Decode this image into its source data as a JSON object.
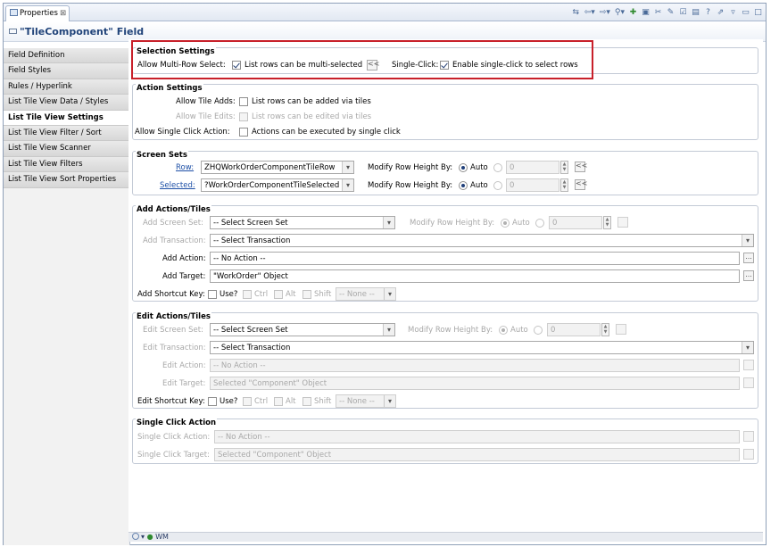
{
  "tab": {
    "title": "Properties",
    "close": "⊠"
  },
  "toolbar": {
    "icons": [
      "link-icon",
      "back-icon",
      "dropdown-icon",
      "forward-icon",
      "dropdown-icon",
      "history-icon",
      "dropdown-icon",
      "add-icon",
      "new-icon",
      "cut-icon",
      "edit-icon",
      "check-icon",
      "save-icon",
      "help-icon",
      "export-icon",
      "view-menu-icon",
      "minimize-icon",
      "maximize-icon"
    ]
  },
  "header": {
    "title": "\"TileComponent\" Field"
  },
  "nav": {
    "items": [
      "Field Definition",
      "Field Styles",
      "Rules / Hyperlink",
      "List Tile View Data / Styles",
      "List Tile View Settings",
      "List Tile View Filter / Sort",
      "List Tile View Scanner",
      "List Tile View Filters",
      "List Tile View Sort Properties"
    ],
    "selected": 4
  },
  "selection": {
    "title": "Selection Settings",
    "multi_label": "Allow Multi-Row Select:",
    "multi_cb": "List rows can be multi-selected",
    "multi_btn": "<<",
    "single_label": "Single-Click:",
    "single_cb": "Enable single-click to select rows"
  },
  "action": {
    "title": "Action Settings",
    "adds_label": "Allow Tile Adds:",
    "adds_cb": "List rows can be added via tiles",
    "edits_label": "Allow Tile Edits:",
    "edits_cb": "List rows can be edited via tiles",
    "click_label": "Allow Single Click Action:",
    "click_cb": "Actions can be executed by single click"
  },
  "screen": {
    "title": "Screen Sets",
    "row_label": "Row:",
    "row_value": "ZHQWorkOrderComponentTileRow",
    "sel_label": "Selected:",
    "sel_value": "?WorkOrderComponentTileSelected",
    "modify_label": "Modify Row Height By:",
    "auto": "Auto",
    "height": "0",
    "btn": "<<"
  },
  "add": {
    "title": "Add Actions/Tiles",
    "screen_label": "Add Screen Set:",
    "screen_value": "-- Select Screen Set",
    "modify_label": "Modify Row Height By:",
    "auto": "Auto",
    "height": "0",
    "trans_label": "Add Transaction:",
    "trans_value": "-- Select Transaction",
    "action_label": "Add Action:",
    "action_value": "-- No Action --",
    "target_label": "Add Target:",
    "target_value": "\"WorkOrder\" Object",
    "browse": "...",
    "key_label": "Add Shortcut Key:",
    "use": "Use?",
    "ctrl": "Ctrl",
    "alt": "Alt",
    "shift": "Shift",
    "none": "-- None --"
  },
  "edit": {
    "title": "Edit Actions/Tiles",
    "screen_label": "Edit Screen Set:",
    "screen_value": "-- Select Screen Set",
    "modify_label": "Modify Row Height By:",
    "auto": "Auto",
    "height": "0",
    "trans_label": "Edit Transaction:",
    "trans_value": "-- Select Transaction",
    "action_label": "Edit Action:",
    "action_value": "-- No Action --",
    "target_label": "Edit Target:",
    "target_value": "Selected \"Component\" Object",
    "key_label": "Edit Shortcut Key:",
    "use": "Use?",
    "ctrl": "Ctrl",
    "alt": "Alt",
    "shift": "Shift",
    "none": "-- None --"
  },
  "single": {
    "title": "Single Click Action",
    "action_label": "Single Click Action:",
    "action_value": "-- No Action --",
    "target_label": "Single Click Target:",
    "target_value": "Selected \"Component\" Object"
  },
  "status": {
    "text": "WM"
  },
  "colors": {
    "highlight": "#c8202a",
    "header": "#21447a",
    "link": "#1d4fa6"
  }
}
